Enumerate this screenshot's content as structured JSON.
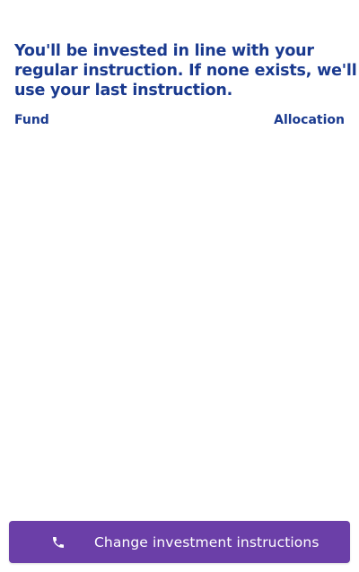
{
  "intro": {
    "text": "You'll be invested in line with your regular instruction. If none exists, we'll use your last instruction."
  },
  "table": {
    "columns": {
      "fund": "Fund",
      "allocation": "Allocation"
    },
    "rows": []
  },
  "cta": {
    "label": "Change investment instructions",
    "icon": "phone-icon"
  },
  "colors": {
    "heading": "#1a3a8f",
    "button": "#6b3fa8",
    "button_text": "#ffffff",
    "background": "#ffffff"
  }
}
